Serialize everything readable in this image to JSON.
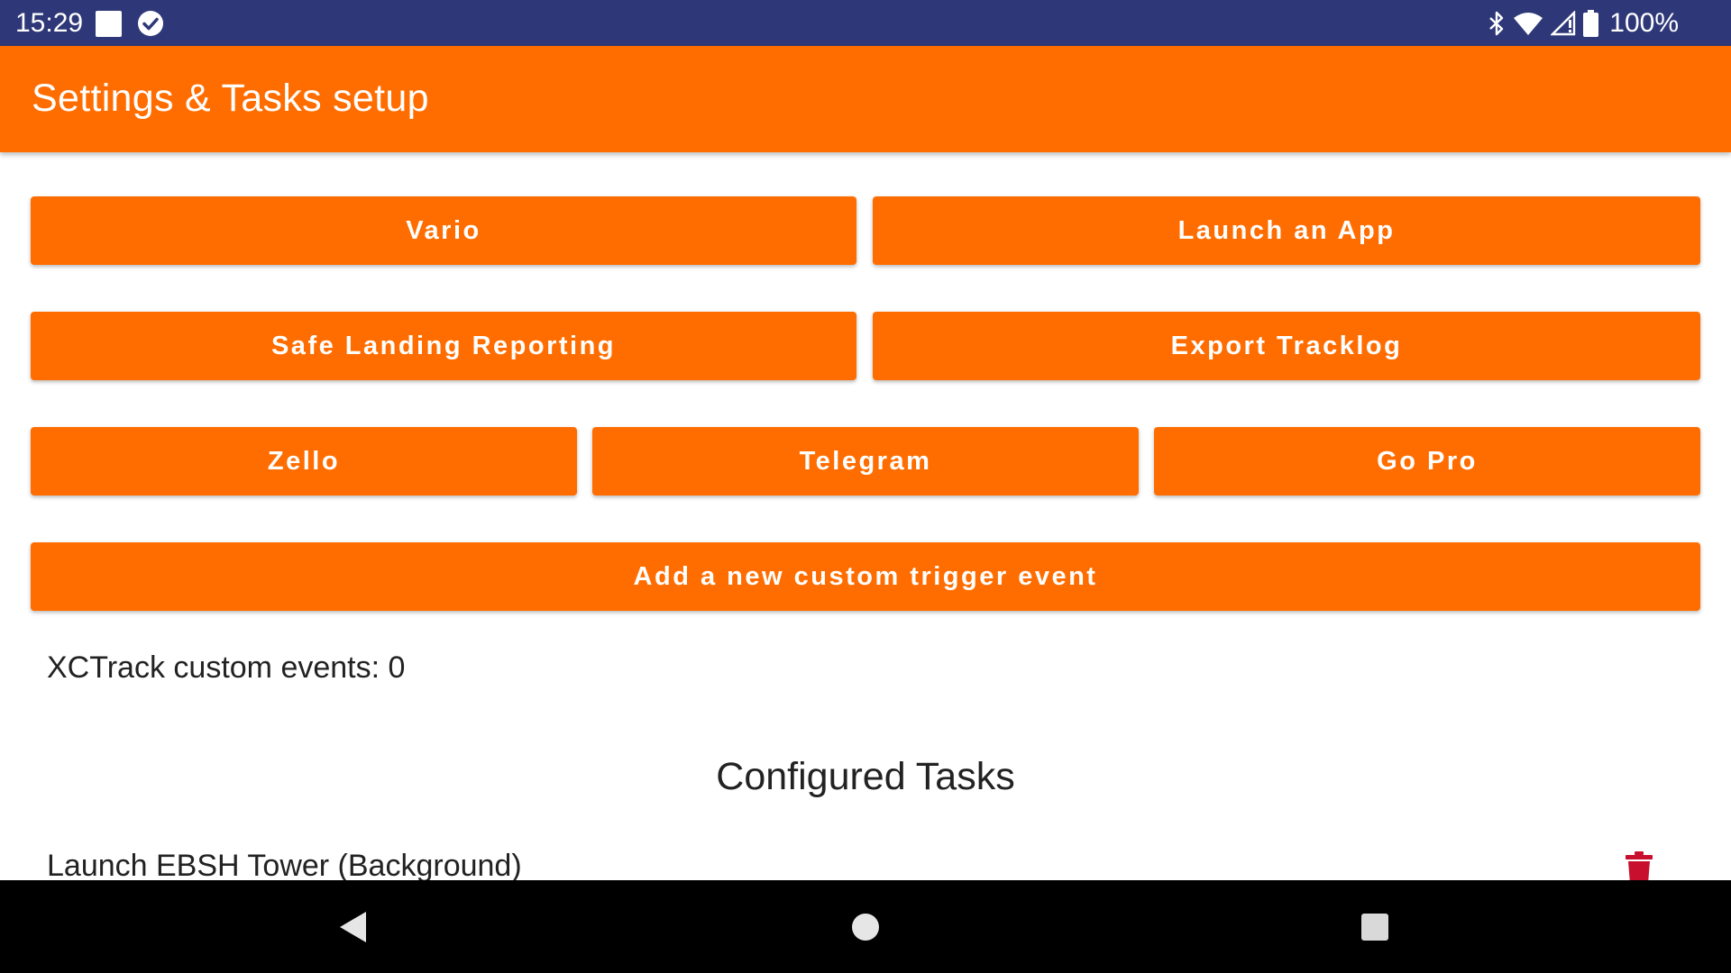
{
  "status_bar": {
    "time": "15:29",
    "battery": "100%",
    "icons": [
      "notification-square-icon",
      "check-circle-icon",
      "bluetooth-icon",
      "wifi-icon",
      "cell-signal-icon",
      "battery-icon"
    ]
  },
  "app_bar": {
    "title": "Settings & Tasks setup"
  },
  "buttons": {
    "vario": "Vario",
    "launch_app": "Launch an App",
    "safe_landing": "Safe Landing Reporting",
    "export_tracklog": "Export Tracklog",
    "zello": "Zello",
    "telegram": "Telegram",
    "go_pro": "Go Pro",
    "add_custom_trigger": "Add a new custom trigger event"
  },
  "events": {
    "label": "XCTrack custom events: 0"
  },
  "tasks": {
    "section_title": "Configured Tasks",
    "items": [
      {
        "label": "Launch EBSH Tower (Background)",
        "icon": "trash-icon"
      }
    ]
  },
  "nav_bar": {
    "icons": [
      "back-icon",
      "home-icon",
      "recents-icon"
    ]
  },
  "colors": {
    "status_bar": "#2e3878",
    "accent": "#ff6d00",
    "delete": "#c8102e",
    "nav_bar": "#000000"
  }
}
